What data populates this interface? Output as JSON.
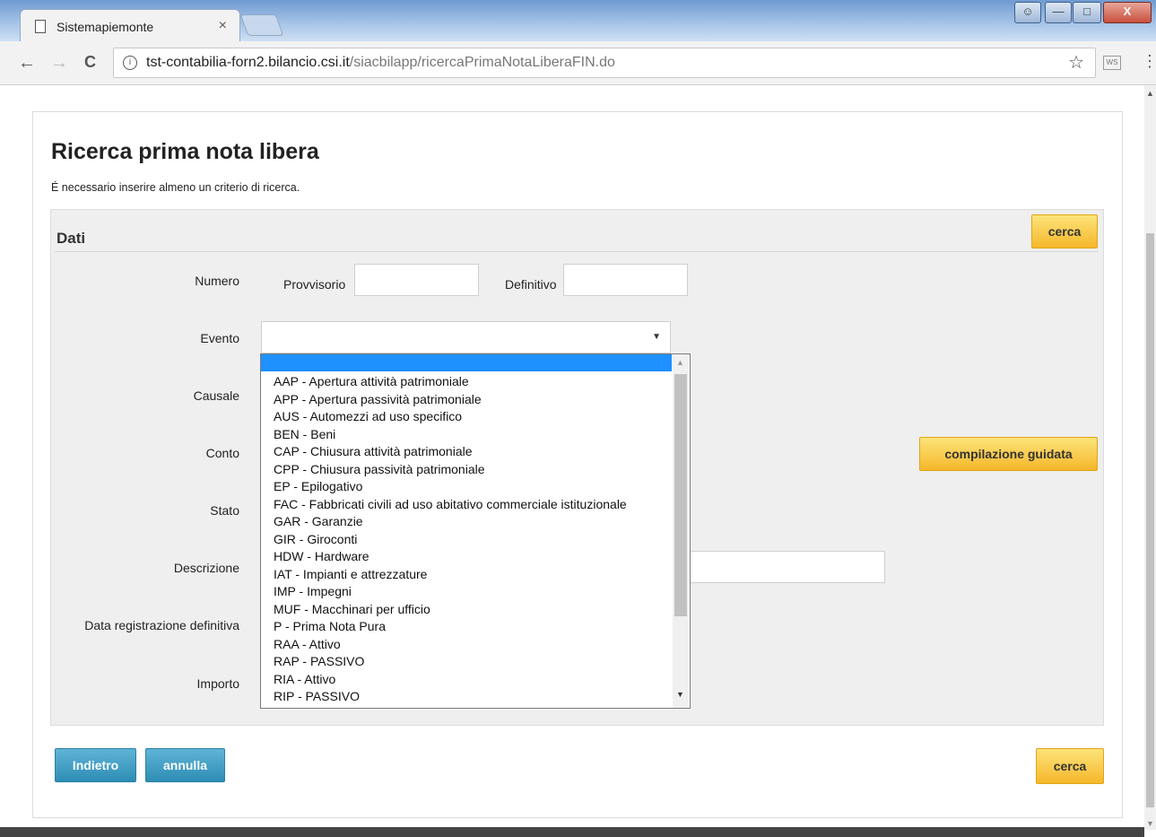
{
  "browser": {
    "tab_title": "Sistemapiemonte",
    "tab_close": "×",
    "url_host": "tst-contabilia-forn2.bilancio.csi.it",
    "url_path": "/siacbilapp/ricercaPrimaNotaLiberaFIN.do",
    "info_glyph": "i",
    "ext_label": "WS",
    "back": "←",
    "forward": "→",
    "reload": "C",
    "star": "☆",
    "menu": "⋮"
  },
  "page": {
    "title": "Ricerca prima nota libera",
    "subtitle": "É necessario inserire almeno un criterio di ricerca."
  },
  "panel": {
    "title": "Dati",
    "search_button": "cerca",
    "guided_button": "compilazione guidata"
  },
  "form": {
    "numero_label": "Numero",
    "provvisorio_label": "Provvisorio",
    "definitivo_label": "Definitivo",
    "evento_label": "Evento",
    "causale_label": "Causale",
    "conto_label": "Conto",
    "stato_label": "Stato",
    "descrizione_label": "Descrizione",
    "data_label": "Data registrazione definitiva",
    "importo_label": "Importo",
    "provvisorio_value": "",
    "definitivo_value": "",
    "evento_value": "",
    "descrizione_value": ""
  },
  "dropdown": {
    "options": [
      "AAP - Apertura attività patrimoniale",
      "APP - Apertura passività patrimoniale",
      "AUS - Automezzi ad uso specifico",
      "BEN - Beni",
      "CAP - Chiusura attività patrimoniale",
      "CPP - Chiusura passività patrimoniale",
      "EP - Epilogativo",
      "FAC - Fabbricati civili ad uso abitativo commerciale istituzionale",
      "GAR - Garanzie",
      "GIR - Giroconti",
      "HDW - Hardware",
      "IAT - Impianti e attrezzature",
      "IMP - Impegni",
      "MUF - Macchinari per ufficio",
      "P - Prima Nota Pura",
      "RAA - Attivo",
      "RAP - PASSIVO",
      "RIA - Attivo",
      "RIP - PASSIVO"
    ]
  },
  "footer": {
    "back_button": "Indietro",
    "cancel_button": "annulla",
    "search_button": "cerca"
  },
  "colors": {
    "accent_yellow": "#f5b72b",
    "accent_blue": "#2e8db5",
    "highlight": "#1e90ff"
  }
}
